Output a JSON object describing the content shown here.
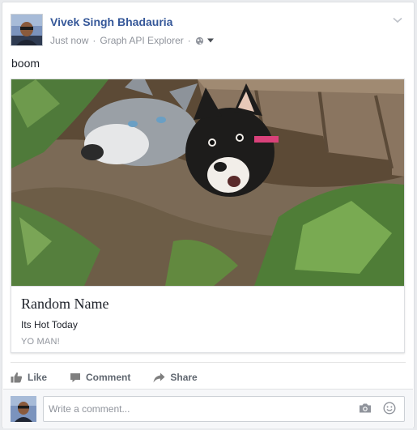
{
  "post": {
    "author": "Vivek Singh Bhadauria",
    "time": "Just now",
    "separator": "·",
    "app": "Graph API Explorer",
    "privacy_icon": "globe-icon",
    "message": "boom"
  },
  "attachment": {
    "image_alt": "Two dogs peeking under a wooden fence",
    "title": "Random Name",
    "description": "Its Hot Today",
    "domain": "YO MAN!"
  },
  "actions": {
    "like": "Like",
    "comment": "Comment",
    "share": "Share"
  },
  "comment_box": {
    "placeholder": "Write a comment..."
  },
  "colors": {
    "author_link": "#365899",
    "meta_text": "#90949c",
    "action_text": "#606770"
  }
}
